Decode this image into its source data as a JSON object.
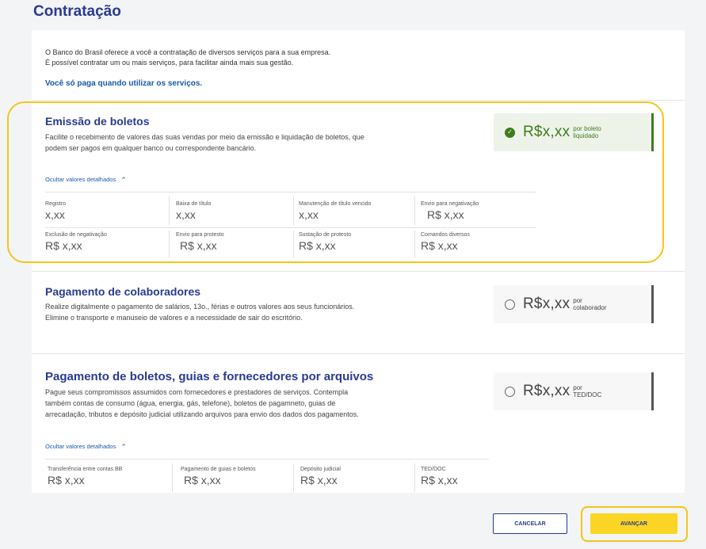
{
  "page": {
    "title": "Contratação",
    "intro_line1": "O Banco do Brasil oferece a você a contratação de diversos serviços para a sua empresa.",
    "intro_line2": "É possível contratar um ou mais serviços, para facilitar ainda mais sua gestão.",
    "intro_link": "Você só paga quando utilizar os serviços."
  },
  "services": [
    {
      "title": "Emissão de boletos",
      "desc_line1": "Facilite o recebimento de valores das suas vendas por meio da emissão e liquidação de boletos, que",
      "desc_line2": "podem ser pagos em qualquer banco ou correspondente bancário.",
      "price": "R$x,xx",
      "unit_line1": "por boleto",
      "unit_line2": "liquidado",
      "selected": true,
      "toggle_label": "Ocultar valores detalhados",
      "details": [
        {
          "label": "Registro",
          "value": "x,xx"
        },
        {
          "label": "Baixa de título",
          "value": "x,xx"
        },
        {
          "label": "Manutenção de título vencido",
          "value": "x,xx"
        },
        {
          "label": "Envio para negativação",
          "value": "R$ x,xx"
        },
        {
          "label": "Exclusão de negativação",
          "value": "R$ x,xx"
        },
        {
          "label": "Envio para protesto",
          "value": "R$ x,xx"
        },
        {
          "label": "Sustação de protesto",
          "value": "R$ x,xx"
        },
        {
          "label": "Comandos diversos",
          "value": "R$ x,xx"
        }
      ]
    },
    {
      "title": "Pagamento de colaboradores",
      "desc_line1": "Realize digitalmente o pagamento de salários, 13o., férias e outros valores aos seus funcionários.",
      "desc_line2": "Elimine o transporte e manuseio de valores e a necessidade de sair do escritório.",
      "price": "R$x,xx",
      "unit_line1": "por",
      "unit_line2": "colaborador",
      "selected": false
    },
    {
      "title": "Pagamento de boletos, guias e fornecedores por arquivos",
      "desc_line1": "Pague seus compromissos assumidos com fornecedores e prestadores de serviços. Contempla",
      "desc_line2": "também contas de consumo (água, energia, gás, telefone), boletos de pagamneto, guias de",
      "desc_line3": "arrecadação, tributos e depósito judicial utilizando arquivos para envio dos dados dos pagamentos.",
      "price": "R$x,xx",
      "unit_line1": "por",
      "unit_line2": "TED/DOC",
      "selected": false,
      "toggle_label": "Ocultar valores detalhados",
      "details": [
        {
          "label": "Transferência entre contas BB",
          "value": "R$ x,xx"
        },
        {
          "label": "Pagamento de guias e boletos",
          "value": "R$ x,xx"
        },
        {
          "label": "Depósito judicial",
          "value": "R$ x,xx"
        },
        {
          "label": "TED/DOC",
          "value": "R$ x,xx"
        }
      ]
    }
  ],
  "actions": {
    "cancel_label": "CANCELAR",
    "next_label": "AVANÇAR"
  },
  "colors": {
    "brand_blue": "#2a3b8f",
    "highlight": "#f5c518",
    "selected_green": "#3e7d1c",
    "primary_button": "#fbd524"
  }
}
